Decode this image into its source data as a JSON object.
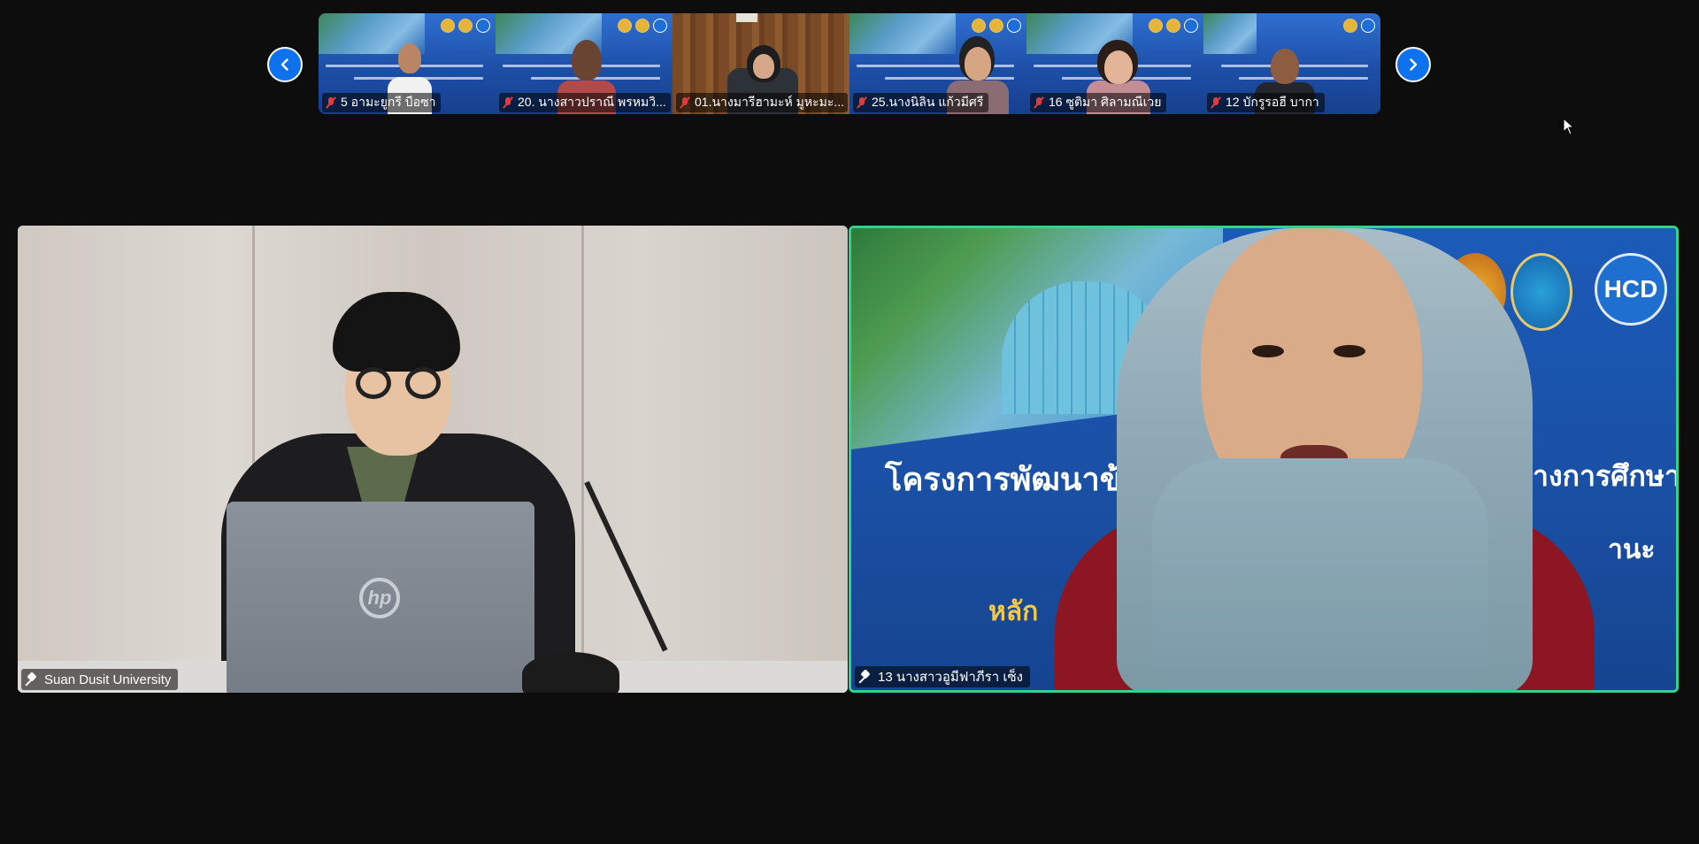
{
  "thumbnails": [
    {
      "label": "5 อามะยูกรี บือซา",
      "muted": true
    },
    {
      "label": "20. นางสาวปราณี  พรหมวิ...",
      "muted": true
    },
    {
      "label": "01.นางมารีฮามะห์  มูหะมะ...",
      "muted": true
    },
    {
      "label": "25.นางนิลิน แก้วมีศรี",
      "muted": true
    },
    {
      "label": "16 ซูติมา ศิลามณีเวย",
      "muted": true
    },
    {
      "label": "12 บักรูรอฮี  บากา",
      "muted": true
    }
  ],
  "main": {
    "left_tile": {
      "name": "Suan Dusit University"
    },
    "right_tile": {
      "name": "13 นางสาวอูมีฟาภีรา เซ็ง",
      "active_speaker": true
    }
  },
  "slide": {
    "line1": "โครงการพัฒนาข้าร",
    "line1_end": "างการศึกษา",
    "line2_end": "านะ",
    "line3": "หลัก",
    "logo_text": "HCD"
  },
  "laptop_brand": "hp",
  "colors": {
    "nav_button": "#0e72ed",
    "active_speaker_border": "#2fd38c",
    "muted_icon": "#e23b3b",
    "background": "#0d0d0d"
  },
  "icons": {
    "prev": "chevron-left-icon",
    "next": "chevron-right-icon",
    "muted": "mic-off-icon",
    "pinned": "pin-icon"
  }
}
